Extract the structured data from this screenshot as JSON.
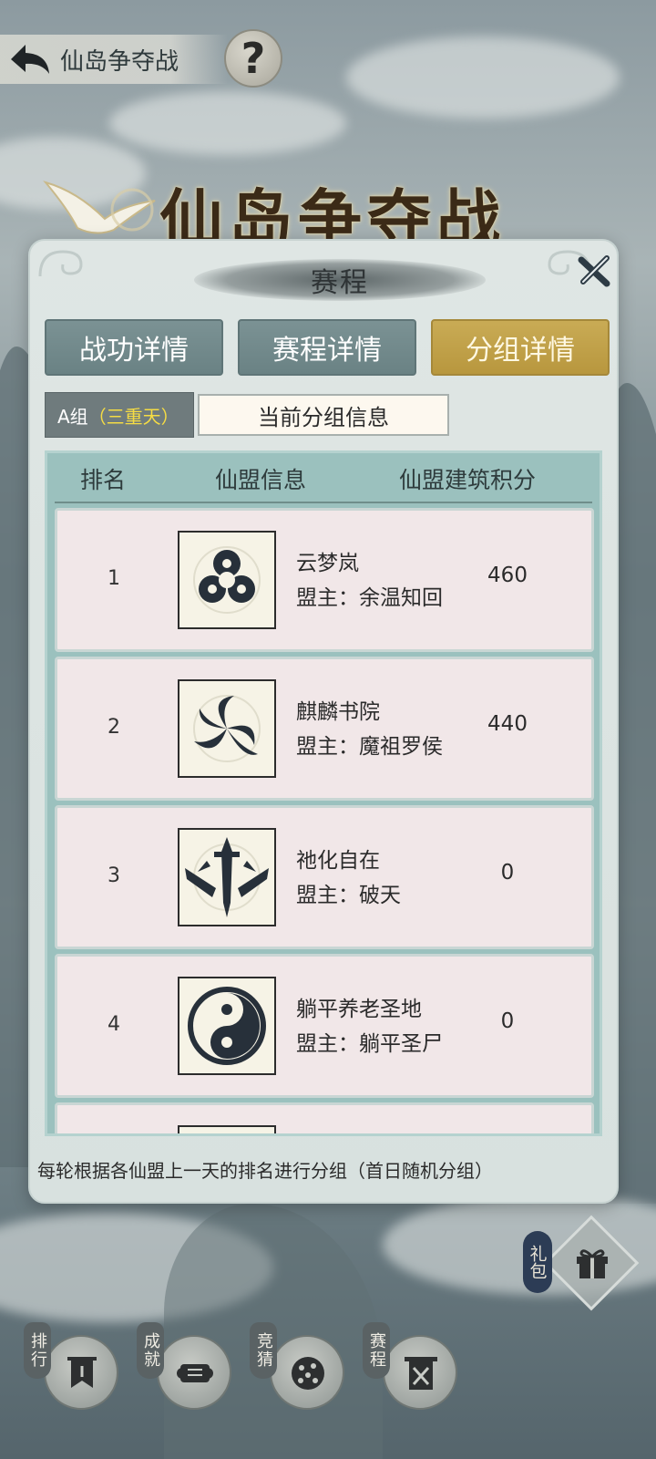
{
  "topbar": {
    "title": "仙岛争夺战"
  },
  "banner_title": "仙岛争夺战",
  "dialog": {
    "title": "赛程",
    "tabs": [
      {
        "label": "战功详情",
        "active": false
      },
      {
        "label": "赛程详情",
        "active": false
      },
      {
        "label": "分组详情",
        "active": true
      }
    ],
    "group_selector": {
      "group": "A组",
      "level": "（三重天）"
    },
    "info_field": "当前分组信息",
    "table": {
      "columns": [
        "排名",
        "仙盟信息",
        "仙盟建筑积分"
      ],
      "rows": [
        {
          "rank": "1",
          "emblem": "trefoil-emblem-icon",
          "name": "云梦岚",
          "leader": "盟主：余温知回",
          "score": "460"
        },
        {
          "rank": "2",
          "emblem": "vortex-emblem-icon",
          "name": "麒麟书院",
          "leader": "盟主：魔祖罗侯",
          "score": "440"
        },
        {
          "rank": "3",
          "emblem": "swords-emblem-icon",
          "name": "祂化自在",
          "leader": "盟主：破天",
          "score": "0"
        },
        {
          "rank": "4",
          "emblem": "yinyang-emblem-icon",
          "name": "躺平养老圣地",
          "leader": "盟主：躺平圣尸",
          "score": "0"
        }
      ]
    },
    "footer": "每轮根据各仙盟上一天的排名进行分组（首日随机分组）"
  },
  "gift": {
    "label": "礼包"
  },
  "bottom_nav": [
    {
      "label": "排行"
    },
    {
      "label": "成就"
    },
    {
      "label": "竞猜"
    },
    {
      "label": "赛程"
    }
  ],
  "colors": {
    "active_tab": "#c9ab55",
    "inactive_tab": "#7b9294",
    "group_level": "#f5dc44",
    "table_panel": "#9bc1be",
    "row_bg": "#f1e7e8"
  }
}
